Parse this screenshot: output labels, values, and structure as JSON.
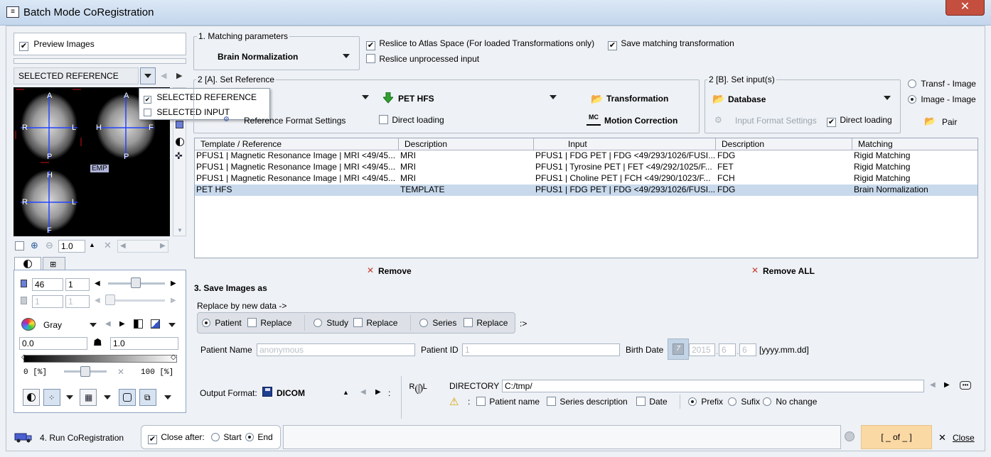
{
  "window": {
    "title": "Batch Mode CoRegistration",
    "close_glyph": "✕"
  },
  "preview": {
    "checkbox_label": "Preview Images",
    "checked": true,
    "reference_select": "SELECTED REFERENCE",
    "menu_items": [
      {
        "label": "SELECTED REFERENCE",
        "checked": true
      },
      {
        "label": "SELECTED INPUT",
        "checked": false
      }
    ],
    "orient_labels": {
      "a": "A",
      "p": "P",
      "r": "R",
      "l": "L",
      "h": "H",
      "f": "F"
    },
    "tmp_badge": "EMP",
    "zoom_value": "1.0"
  },
  "controls": {
    "tab1_icon": "contrast-icon",
    "tab2_icon": "grid-icon",
    "slice_value": "46",
    "slice_count": "1",
    "slice2_value": "1",
    "slice2_count": "1",
    "colormap": "Gray",
    "min_value": "0.0",
    "max_value": "1.0",
    "range_low": "0",
    "range_low_unit": "[%]",
    "range_high": "100",
    "range_high_unit": "[%]",
    "range_x": "✕"
  },
  "matching": {
    "group_title": "1. Matching parameters",
    "method": "Brain Normalization",
    "reslice_atlas": {
      "label": "Reslice to Atlas Space (For loaded Transformations only)",
      "checked": true
    },
    "save_matching": {
      "label": "Save matching transformation",
      "checked": true
    },
    "reslice_unprocessed": {
      "label": "Reslice unprocessed input",
      "checked": false
    }
  },
  "reference": {
    "group_title": "2 [A]. Set Reference",
    "template": "PET HFS",
    "transformation": "Transformation",
    "format_settings": "Reference Format Settings",
    "direct_loading": {
      "label": "Direct loading",
      "checked": false
    },
    "motion_correction": "Motion Correction",
    "mc_glyph": "MC"
  },
  "input": {
    "group_title": "2 [B]. Set input(s)",
    "source": "Database",
    "format_settings": "Input Format Settings",
    "direct_loading": {
      "label": "Direct loading",
      "checked": true
    },
    "mode_transf": "Transf - Image",
    "mode_image": "Image - Image",
    "pair": "Pair"
  },
  "table": {
    "columns": [
      "Template / Reference",
      "Description",
      "Input",
      "Description",
      "Matching"
    ],
    "rows": [
      [
        "PFUS1 | Magnetic Resonance Image | MRI <49/45...",
        "MRI",
        "PFUS1 | FDG PET | FDG <49/293/1026/FUSI...",
        "FDG",
        "Rigid Matching"
      ],
      [
        "PFUS1 | Magnetic Resonance Image | MRI <49/45...",
        "MRI",
        "PFUS1 | Tyrosine PET | FET <49/292/1025/F...",
        "FET",
        "Rigid Matching"
      ],
      [
        "PFUS1 | Magnetic Resonance Image | MRI <49/45...",
        "MRI",
        "PFUS1 | Choline PET | FCH <49/290/1023/F...",
        "FCH",
        "Rigid Matching"
      ],
      [
        "PET HFS",
        "TEMPLATE",
        "PFUS1 | FDG PET | FDG <49/293/1026/FUSI...",
        "FDG",
        "Brain Normalization"
      ]
    ],
    "remove": "Remove",
    "remove_all": "Remove ALL"
  },
  "save": {
    "section_title": "3. Save Images as",
    "replace_label": "Replace by new data ->",
    "patient": "Patient",
    "study": "Study",
    "series": "Series",
    "replace": "Replace",
    "arrow": ":>",
    "patient_name_label": "Patient Name",
    "patient_name": "anonymous",
    "patient_id_label": "Patient ID",
    "patient_id": "1",
    "birth_date_label": "Birth Date",
    "birth_year": "2015",
    "birth_month": "6",
    "birth_day": "6",
    "date_format": "[yyyy.mm.dd]",
    "output_format_label": "Output Format:",
    "output_format": "DICOM",
    "directory_label": "DIRECTORY",
    "directory": "C:/tmp/",
    "opt_patient_name": "Patient name",
    "opt_series_desc": "Series description",
    "opt_date": "Date",
    "prefix": "Prefix",
    "sufix": "Sufix",
    "no_change": "No change"
  },
  "run": {
    "label": "4. Run CoRegistration",
    "close_after": "Close after:",
    "start": "Start",
    "end": "End",
    "counter": "[ _ of _ ]",
    "close": "Close"
  }
}
